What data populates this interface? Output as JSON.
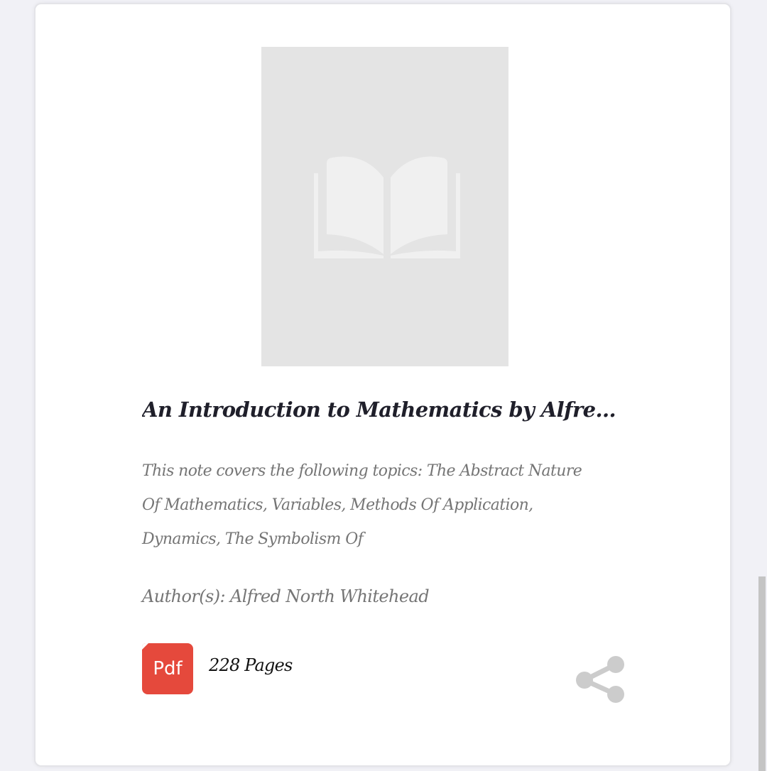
{
  "book": {
    "cover_icon": "open-book-icon",
    "title": "An Introduction to Mathematics by Alfre...",
    "description": "This note covers the following topics: The Abstract Nature Of Mathematics, Variables, Methods Of Application, Dynamics, The Symbolism Of",
    "author": "Author(s): Alfred North Whitehead",
    "format_label": "Pdf",
    "pages": "228 Pages",
    "share_icon": "share-icon"
  },
  "colors": {
    "pdf_badge": "#e5493c",
    "cover_placeholder": "#e4e4e4",
    "text_muted": "#757575",
    "text_dark": "#1f1f2a"
  }
}
